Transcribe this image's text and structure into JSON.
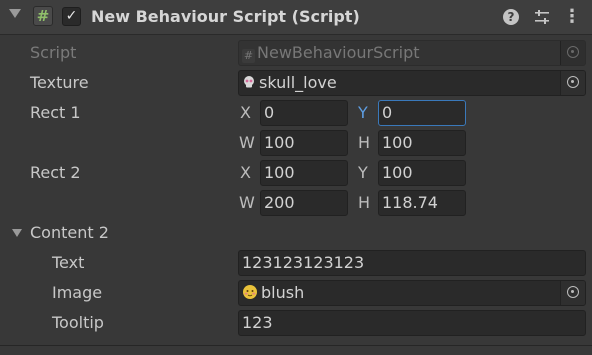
{
  "component": {
    "title": "New Behaviour Script (Script)",
    "enabled": true,
    "icons": {
      "fold": "chevron-down-icon",
      "script": "cs-script-icon",
      "help": "help-icon",
      "presets": "presets-icon",
      "menu": "kebab-menu-icon"
    },
    "help_glyph": "?",
    "menu_glyph": "⋮",
    "check_glyph": "✓",
    "script_glyph": "#"
  },
  "fields": {
    "script": {
      "label": "Script",
      "value": "NewBehaviourScript"
    },
    "texture": {
      "label": "Texture",
      "value": "skull_love"
    },
    "rect1": {
      "label": "Rect 1",
      "x_label": "X",
      "x": "0",
      "y_label": "Y",
      "y": "0",
      "w_label": "W",
      "w": "100",
      "h_label": "H",
      "h": "100"
    },
    "rect2": {
      "label": "Rect 2",
      "x_label": "X",
      "x": "100",
      "y_label": "Y",
      "y": "100",
      "w_label": "W",
      "w": "200",
      "h_label": "H",
      "h": "118.74"
    },
    "content2": {
      "label": "Content 2",
      "expanded": true,
      "text": {
        "label": "Text",
        "value": "123123123123"
      },
      "image": {
        "label": "Image",
        "value": "blush"
      },
      "tooltip": {
        "label": "Tooltip",
        "value": "123"
      }
    }
  },
  "colors": {
    "background": "#383838",
    "field": "#2a2a2a",
    "focus": "#3a79bb",
    "accent_y": "#5e9ee3"
  }
}
